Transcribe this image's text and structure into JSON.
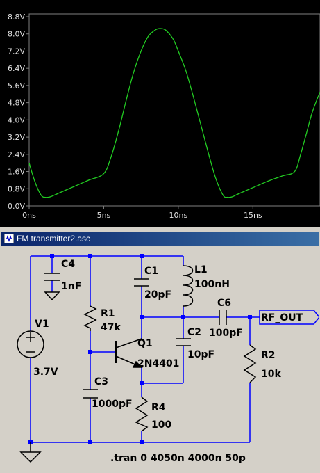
{
  "chart_data": {
    "type": "line",
    "x_unit": "ns",
    "y_unit": "V",
    "xlim": [
      0,
      19.5
    ],
    "ylim": [
      0,
      8.8
    ],
    "x_ticks": [
      "0ns",
      "5ns",
      "10ns",
      "15ns"
    ],
    "x_tick_values": [
      0,
      5,
      10,
      15
    ],
    "y_ticks": [
      "8.8V",
      "8.0V",
      "7.2V",
      "6.4V",
      "5.6V",
      "4.8V",
      "4.0V",
      "3.2V",
      "2.4V",
      "1.6V",
      "0.8V",
      "0.0V"
    ],
    "y_tick_values": [
      8.8,
      8.0,
      7.2,
      6.4,
      5.6,
      4.8,
      4.0,
      3.2,
      2.4,
      1.6,
      0.8,
      0.0
    ],
    "series": [
      {
        "color": "#22cc22",
        "x": [
          0,
          0.4,
          0.8,
          1.1,
          1.4,
          2.0,
          3.0,
          4.0,
          5.0,
          5.5,
          6.0,
          6.5,
          7.0,
          7.5,
          8.0,
          8.5,
          8.8,
          9.1,
          9.4,
          9.7,
          10.0,
          10.5,
          11.0,
          11.5,
          12.0,
          12.5,
          13.0,
          13.3,
          13.6,
          14.0,
          15.0,
          16.0,
          17.0,
          17.8,
          18.2,
          18.6,
          19.0,
          19.5
        ],
        "y": [
          2.0,
          1.1,
          0.5,
          0.4,
          0.42,
          0.6,
          0.9,
          1.2,
          1.5,
          2.3,
          3.5,
          4.9,
          6.2,
          7.2,
          7.9,
          8.2,
          8.25,
          8.2,
          8.0,
          7.7,
          7.2,
          6.3,
          5.1,
          3.8,
          2.5,
          1.3,
          0.5,
          0.4,
          0.42,
          0.55,
          0.85,
          1.15,
          1.4,
          1.6,
          2.4,
          3.4,
          4.4,
          5.3
        ]
      }
    ]
  },
  "window": {
    "title": "FM transmitter2.asc",
    "icon": "ltspice-schematic-icon"
  },
  "schematic": {
    "components": {
      "c4": {
        "name": "C4",
        "value": "1nF"
      },
      "v1": {
        "name": "V1",
        "value": "3.7V"
      },
      "r1": {
        "name": "R1",
        "value": "47k"
      },
      "c1": {
        "name": "C1",
        "value": "20pF"
      },
      "l1": {
        "name": "L1",
        "value": "100nH"
      },
      "c6": {
        "name": "C6",
        "value": "100pF"
      },
      "q1": {
        "name": "Q1",
        "value": "2N4401"
      },
      "c2": {
        "name": "C2",
        "value": "10pF"
      },
      "c3": {
        "name": "C3",
        "value": "1000pF"
      },
      "r4": {
        "name": "R4",
        "value": "100"
      },
      "r2": {
        "name": "R2",
        "value": "10k"
      }
    },
    "net_label": "RF_OUT",
    "directive": ".tran 0 4050n 4000n 50p",
    "colors": {
      "wire": "#0000ff",
      "component": "#000000",
      "plus_sign": "#000000",
      "net_label_fill": "#d4d0c8"
    }
  }
}
